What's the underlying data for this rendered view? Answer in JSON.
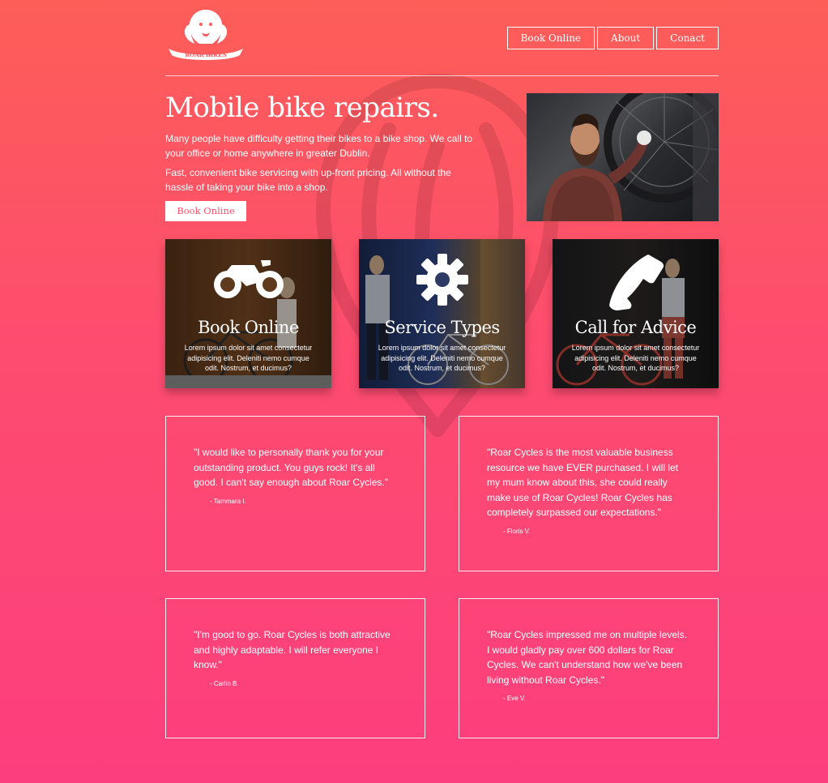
{
  "header": {
    "logo": {
      "line1": "ROAR",
      "line2": "BIKES"
    },
    "nav": [
      {
        "label": "Book Online"
      },
      {
        "label": "About"
      },
      {
        "label": "Conact"
      }
    ]
  },
  "hero": {
    "title": "Mobile bike repairs.",
    "paragraph1": "Many people have difficulty getting their bikes to a bike shop. We call to your office or home anywhere in greater Dublin.",
    "paragraph2": "Fast, convenient bike servicing with up-front pricing. All without the hassle of taking your bike into a shop.",
    "button": "Book Online"
  },
  "cards": [
    {
      "title": "Book Online",
      "icon": "motorcycle-icon",
      "text": "Lorem ipsum dolor sit amet consectetur adipisicing elit. Deleniti nemo cumque odit. Nostrum, et ducimus?"
    },
    {
      "title": "Service Types",
      "icon": "gear-icon",
      "text": "Lorem ipsum dolor sit amet consectetur adipisicing elit. Deleniti nemo cumque odit. Nostrum, et ducimus?"
    },
    {
      "title": "Call for Advice",
      "icon": "phone-icon",
      "text": "Lorem ipsum dolor sit amet consectetur adipisicing elit. Deleniti nemo cumque odit. Nostrum, et ducimus?"
    }
  ],
  "testimonials": [
    {
      "text": "\"I would like to personally thank you for your outstanding product. You guys rock! It's all good. I can't say enough about Roar Cycles.\"",
      "author": "- Tammara I."
    },
    {
      "text": "\"Roar Cycles is the most valuable business resource we have EVER purchased. I will let my mum know about this, she could really make use of Roar Cycles! Roar Cycles has completely surpassed our expectations.\"",
      "author": "- Floris V."
    },
    {
      "text": "\"I'm good to go. Roar Cycles is both attractive and highly adaptable. I will refer everyone I know.\"",
      "author": "- Carlin B."
    },
    {
      "text": "\"Roar Cycles impressed me on multiple levels. I would gladly pay over 600 dollars for Roar Cycles. We can't understand how we've been living without Roar Cycles.\"",
      "author": "- Eve V."
    }
  ],
  "colors": {
    "accent": "#fd4f6a",
    "gradient_top": "#fd5e58",
    "gradient_bottom": "#fd3e7e"
  }
}
